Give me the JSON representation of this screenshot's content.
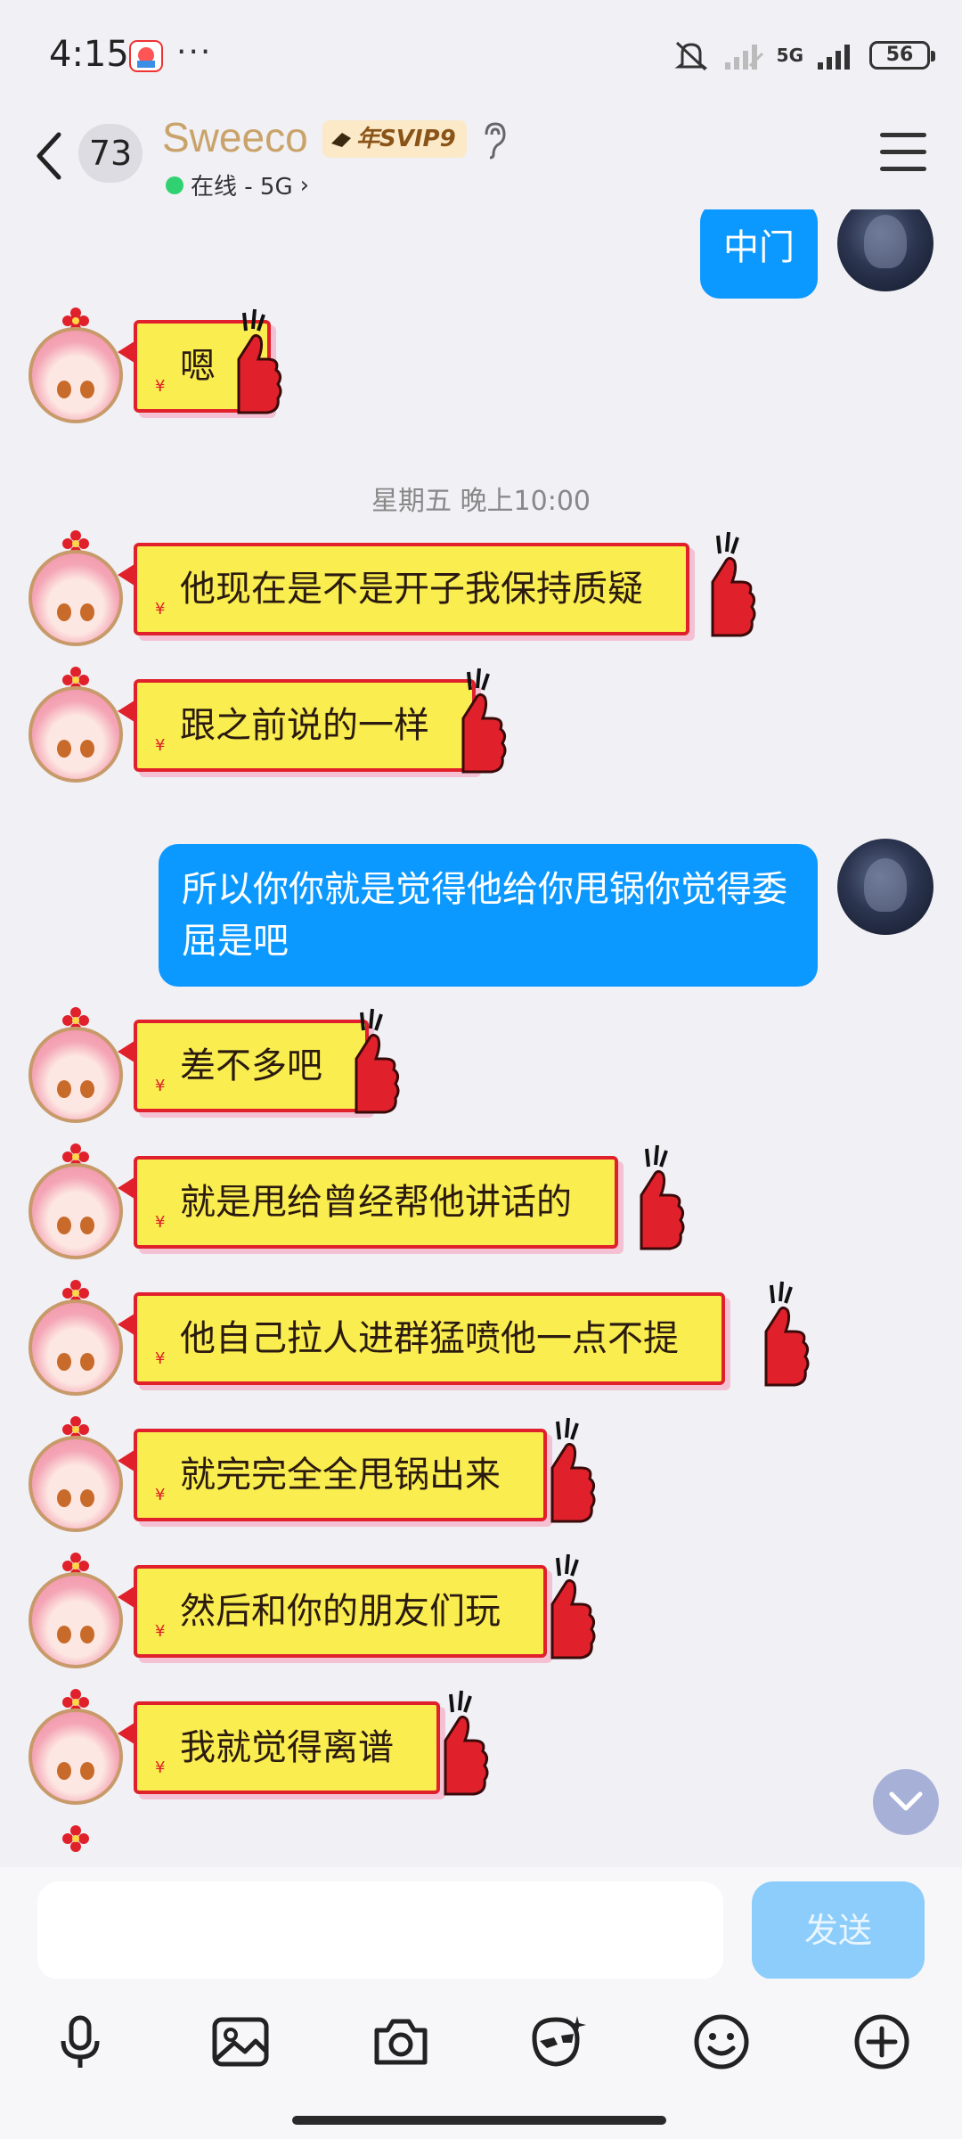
{
  "status_bar": {
    "time": "4:15",
    "more": "···",
    "network": "5G",
    "battery": "56"
  },
  "header": {
    "unread_count": "73",
    "contact_name": "Sweeco",
    "vip_badge": "年SVIP9",
    "presence": "在线 - 5G",
    "presence_chevron": "›"
  },
  "messages": [
    {
      "side": "me",
      "text": "中门"
    },
    {
      "side": "them",
      "text": "嗯"
    },
    {
      "side": "time",
      "text": "星期五 晚上10:00"
    },
    {
      "side": "them",
      "text": "他现在是不是开子我保持质疑"
    },
    {
      "side": "them",
      "text": "跟之前说的一样"
    },
    {
      "side": "me",
      "text": "所以你你就是觉得他给你甩锅你觉得委屈是吧"
    },
    {
      "side": "them",
      "text": "差不多吧"
    },
    {
      "side": "them",
      "text": "就是甩给曾经帮他讲话的"
    },
    {
      "side": "them",
      "text": "他自己拉人进群猛喷他一点不提"
    },
    {
      "side": "them",
      "text": "就完完全全甩锅出来"
    },
    {
      "side": "them",
      "text": "然后和你的朋友们玩"
    },
    {
      "side": "them",
      "text": "我就觉得离谱"
    }
  ],
  "input": {
    "placeholder": "",
    "send_label": "发送"
  },
  "toolbar": [
    "mic-icon",
    "image-icon",
    "camera-icon",
    "sticker-icon",
    "emoji-icon",
    "plus-icon"
  ],
  "colors": {
    "background": "#f0f0f5",
    "my_bubble": "#0c99ff",
    "their_bubble": "#f9ed4f",
    "their_bubble_border": "#e0212b",
    "name_gold": "#c9a36a",
    "online_green": "#2fd170",
    "send_button": "#8ccdfb"
  }
}
